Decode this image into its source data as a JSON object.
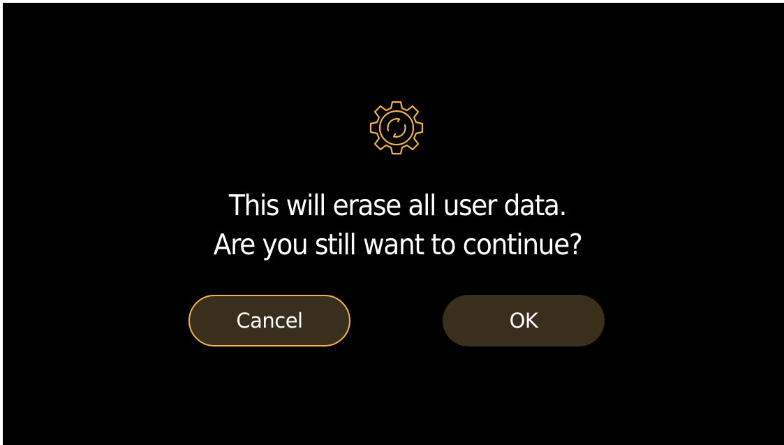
{
  "dialog": {
    "icon": "gear-reset-icon",
    "message_line1": "This will erase all user data.",
    "message_line2": "Are you still want to continue?",
    "cancel_label": "Cancel",
    "ok_label": "OK"
  },
  "colors": {
    "background": "#000000",
    "accent": "#f3b443",
    "button_fill": "#3a2f1d",
    "text": "#ffffff"
  }
}
